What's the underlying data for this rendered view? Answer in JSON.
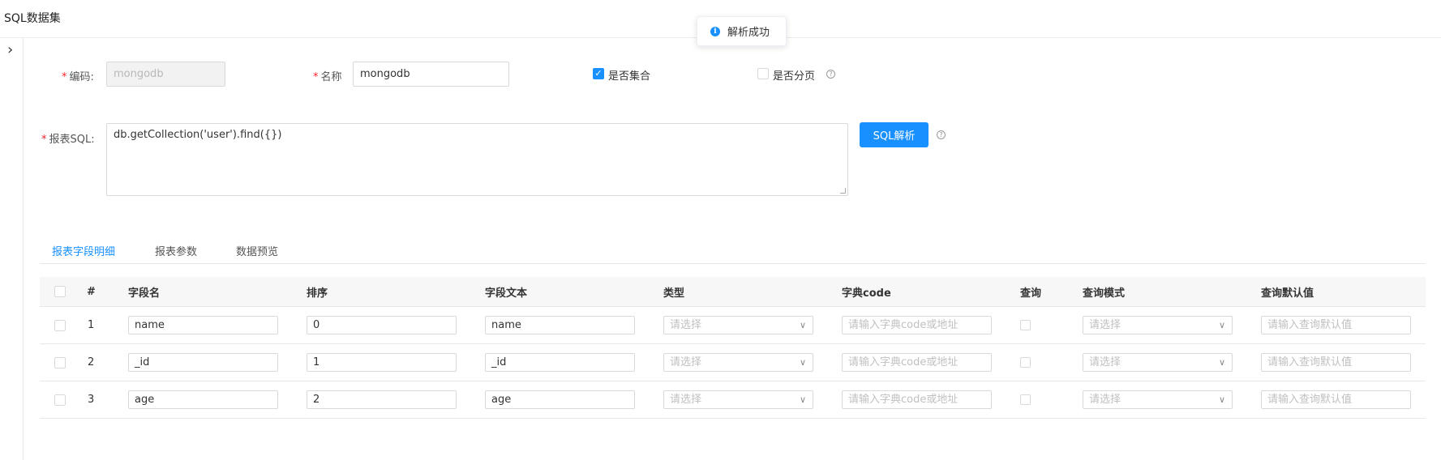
{
  "page": {
    "title": "SQL数据集",
    "expand_icon": "chevron-right-icon"
  },
  "toast": {
    "icon": "info-icon",
    "message": "解析成功",
    "color": "#1890ff"
  },
  "form": {
    "code": {
      "label": "编码:",
      "value": "mongodb"
    },
    "name": {
      "label": "名称",
      "value": "mongodb"
    },
    "is_collection": {
      "label": "是否集合",
      "checked": true
    },
    "is_paging": {
      "label": "是否分页",
      "checked": false
    },
    "sql": {
      "label": "报表SQL:",
      "value": "db.getCollection('user').find({})"
    },
    "parse_button": "SQL解析"
  },
  "tabs": [
    {
      "label": "报表字段明细",
      "active": true
    },
    {
      "label": "报表参数",
      "active": false
    },
    {
      "label": "数据预览",
      "active": false
    }
  ],
  "table": {
    "columns": [
      "#",
      "字段名",
      "排序",
      "字段文本",
      "类型",
      "字典code",
      "查询",
      "查询模式",
      "查询默认值"
    ],
    "placeholders": {
      "type": "请选择",
      "dict_code": "请输入字典code或地址",
      "query_mode": "请选择",
      "default_value": "请输入查询默认值"
    },
    "rows": [
      {
        "index": "1",
        "field_name": "name",
        "order": "0",
        "field_text": "name"
      },
      {
        "index": "2",
        "field_name": "_id",
        "order": "1",
        "field_text": "_id"
      },
      {
        "index": "3",
        "field_name": "age",
        "order": "2",
        "field_text": "age"
      }
    ]
  },
  "colors": {
    "accent": "#1890ff",
    "required": "#f5222d"
  }
}
